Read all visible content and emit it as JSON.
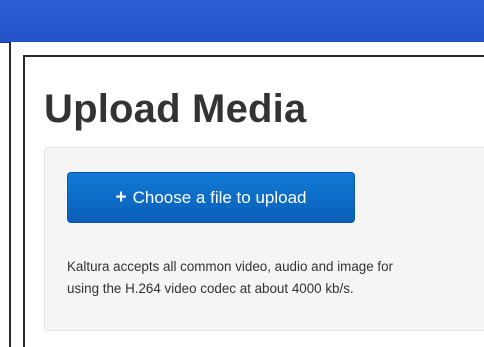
{
  "page": {
    "title": "Upload Media"
  },
  "upload": {
    "button_label": "Choose a file to upload",
    "button_icon": "plus-icon",
    "info_line_1": "Kaltura accepts all common video, audio and image for",
    "info_line_2": "using the H.264 video codec at about 4000 kb/s."
  },
  "colors": {
    "top_bar": "#2352c8",
    "button": "#0a6cc4",
    "title_text": "#333333",
    "panel_bg": "#f5f5f5"
  }
}
